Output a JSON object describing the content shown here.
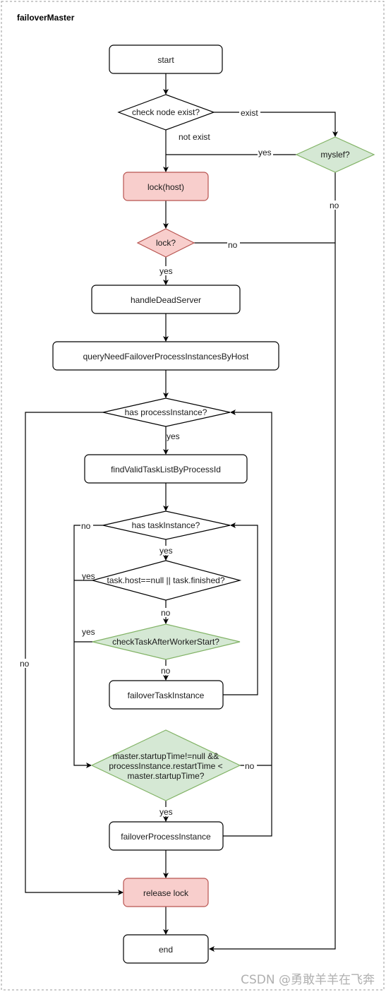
{
  "title": "failoverMaster",
  "watermark": "CSDN @勇敢羊羊在飞奔",
  "colors": {
    "default_fill": "#ffffff",
    "default_stroke": "#000000",
    "red_fill": "#f8cecc",
    "red_stroke": "#b85450",
    "green_fill": "#d5e8d4",
    "green_stroke": "#82b366"
  },
  "nodes": {
    "start": "start",
    "check_node": "check node exist?",
    "myself": "myslef?",
    "lock_host": "lock(host)",
    "lock_q": "lock?",
    "handle_dead": "handleDeadServer",
    "query": "queryNeedFailoverProcessInstancesByHost",
    "has_process": "has processInstance?",
    "find_valid": "findValidTaskListByProcessId",
    "has_task": "has taskInstance?",
    "task_host": "task.host==null || task.finished?",
    "check_task": "checkTaskAfterWorkerStart?",
    "failover_task": "failoverTaskInstance",
    "master_line1": "master.startupTime!=null &&",
    "master_line2": "processInstance.restartTime <",
    "master_line3": "master.startupTime?",
    "failover_process": "failoverProcessInstance",
    "release": "release lock",
    "end": "end"
  },
  "edges": {
    "exist": "exist",
    "not_exist": "not exist",
    "myself_yes": "yes",
    "myself_no": "no",
    "lock_no": "no",
    "lock_yes": "yes",
    "process_yes": "yes",
    "process_no": "no",
    "task_no": "no",
    "task_yes": "yes",
    "host_yes": "yes",
    "host_no": "no",
    "check_yes": "yes",
    "check_no": "no",
    "master_no": "no",
    "master_yes": "yes"
  }
}
